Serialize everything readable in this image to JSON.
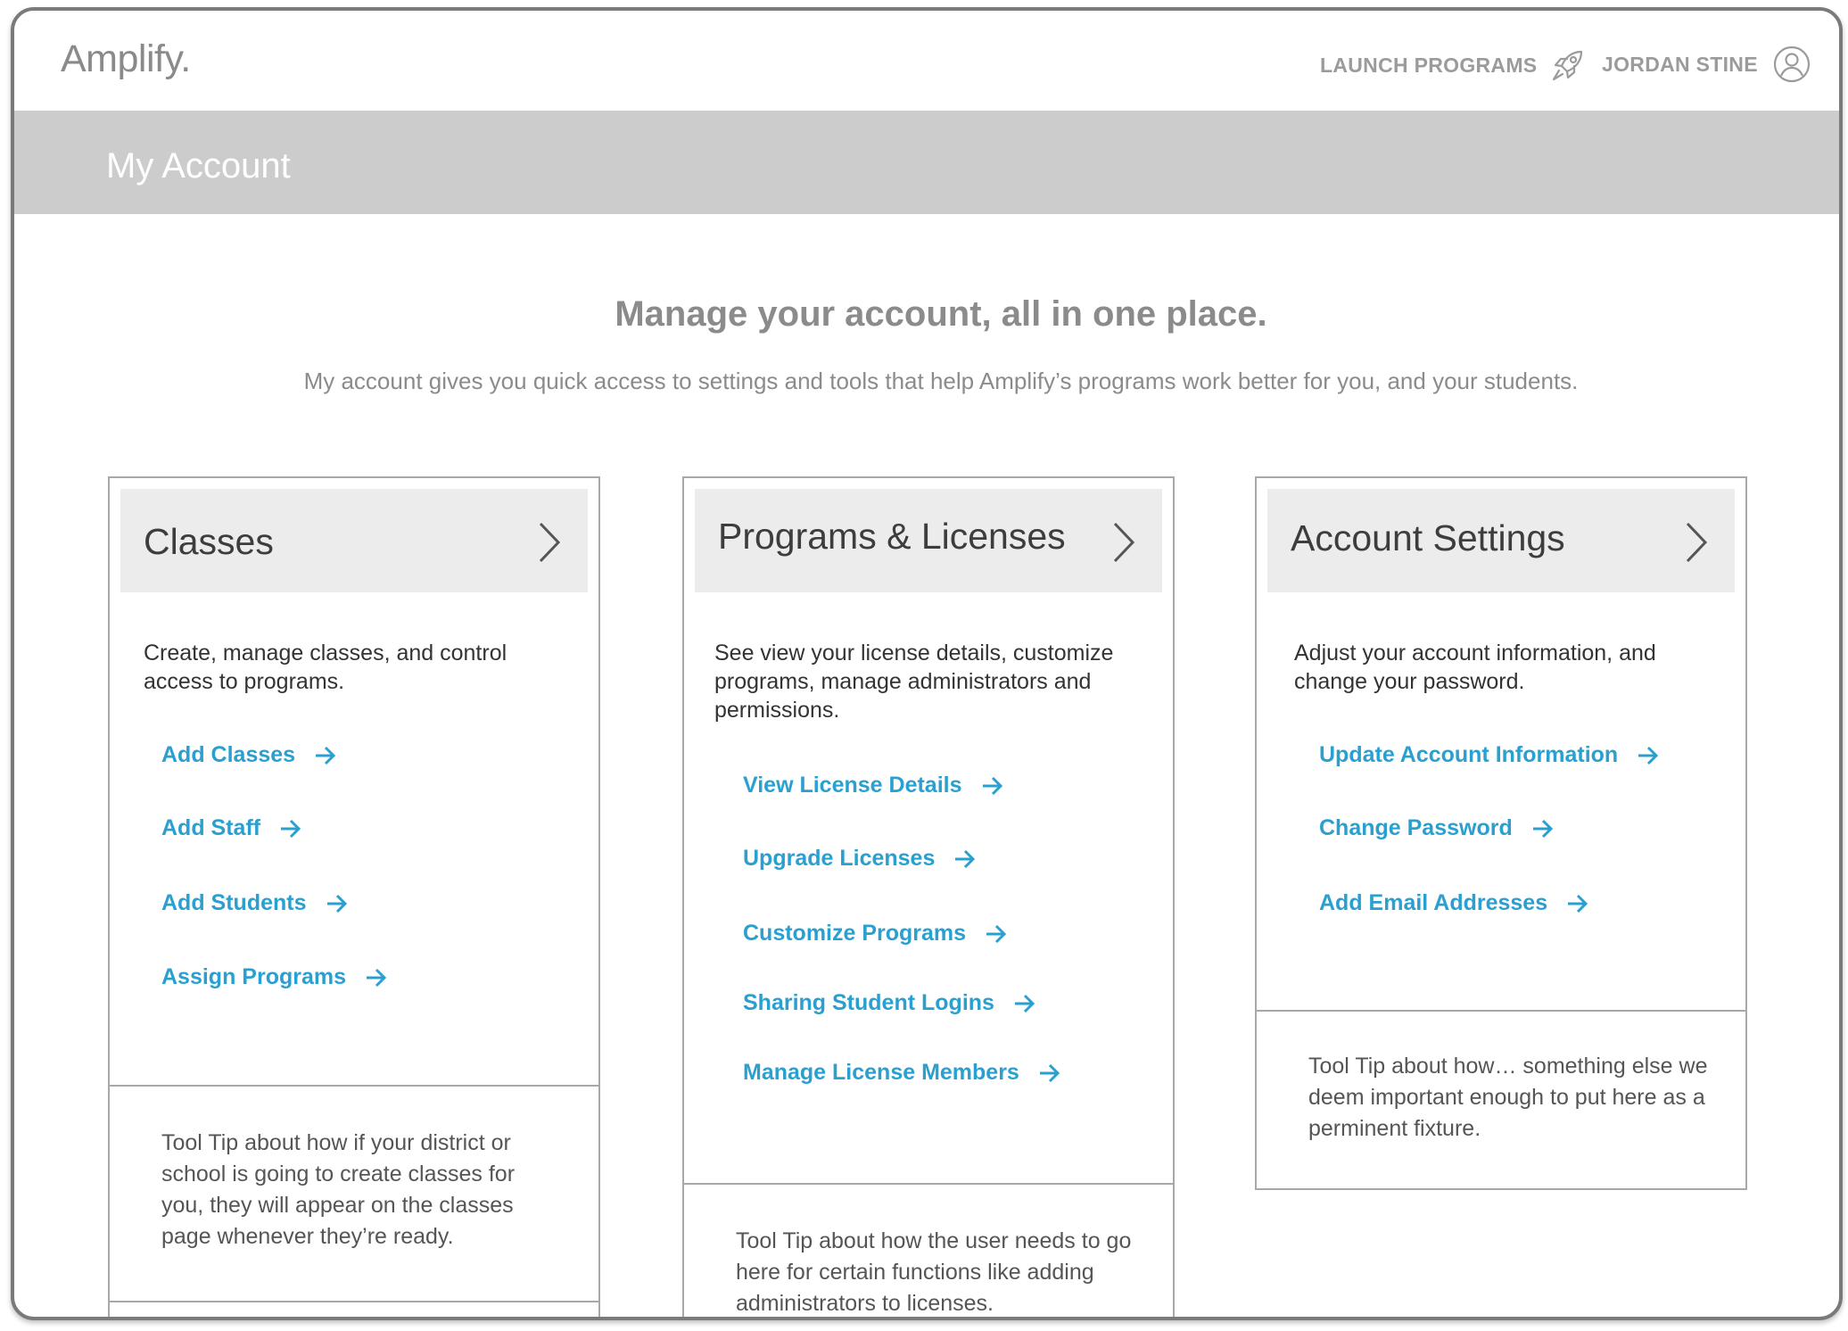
{
  "app": {
    "logo": "Amplify."
  },
  "nav": {
    "launch_programs": "LAUNCH PROGRAMS",
    "user_name": "JORDAN STINE"
  },
  "banner": {
    "title": "My Account"
  },
  "intro": {
    "headline": "Manage your account, all in one place.",
    "subline": "My account gives you quick access to settings and tools that help Amplify’s programs work better for you, and your students."
  },
  "cards": [
    {
      "title": "Classes",
      "description": "Create, manage classes, and control access to programs.",
      "links": [
        "Add Classes",
        "Add Staff",
        "Add Students",
        "Assign Programs"
      ],
      "tooltip": "Tool Tip about how if your district or school is going to create classes for you, they will appear on the classes page whenever they’re ready."
    },
    {
      "title": "Programs & Licenses",
      "description": "See view your license details, customize programs, manage administrators and permissions.",
      "links": [
        "View License Details",
        "Upgrade Licenses",
        "Customize Programs",
        "Sharing Student Logins",
        "Manage License Members"
      ],
      "tooltip": "Tool Tip about how the user needs to go here for certain functions like adding administrators to licenses."
    },
    {
      "title": "Account Settings",
      "description": "Adjust your account information, and change your password.",
      "links": [
        "Update Account Information",
        "Change Password",
        "Add Email Addresses"
      ],
      "tooltip": "Tool Tip about how… something else we deem important enough to put here as a perminent fixture."
    }
  ],
  "colors": {
    "link": "#2aa0d0",
    "banner": "#cccccc",
    "card_header": "#ececec",
    "frame": "#7a7a7a"
  },
  "icons": {
    "launch": "rocket-icon",
    "user": "user-circle-icon",
    "card_open": "chevron-right-icon",
    "link": "arrow-right-icon"
  }
}
